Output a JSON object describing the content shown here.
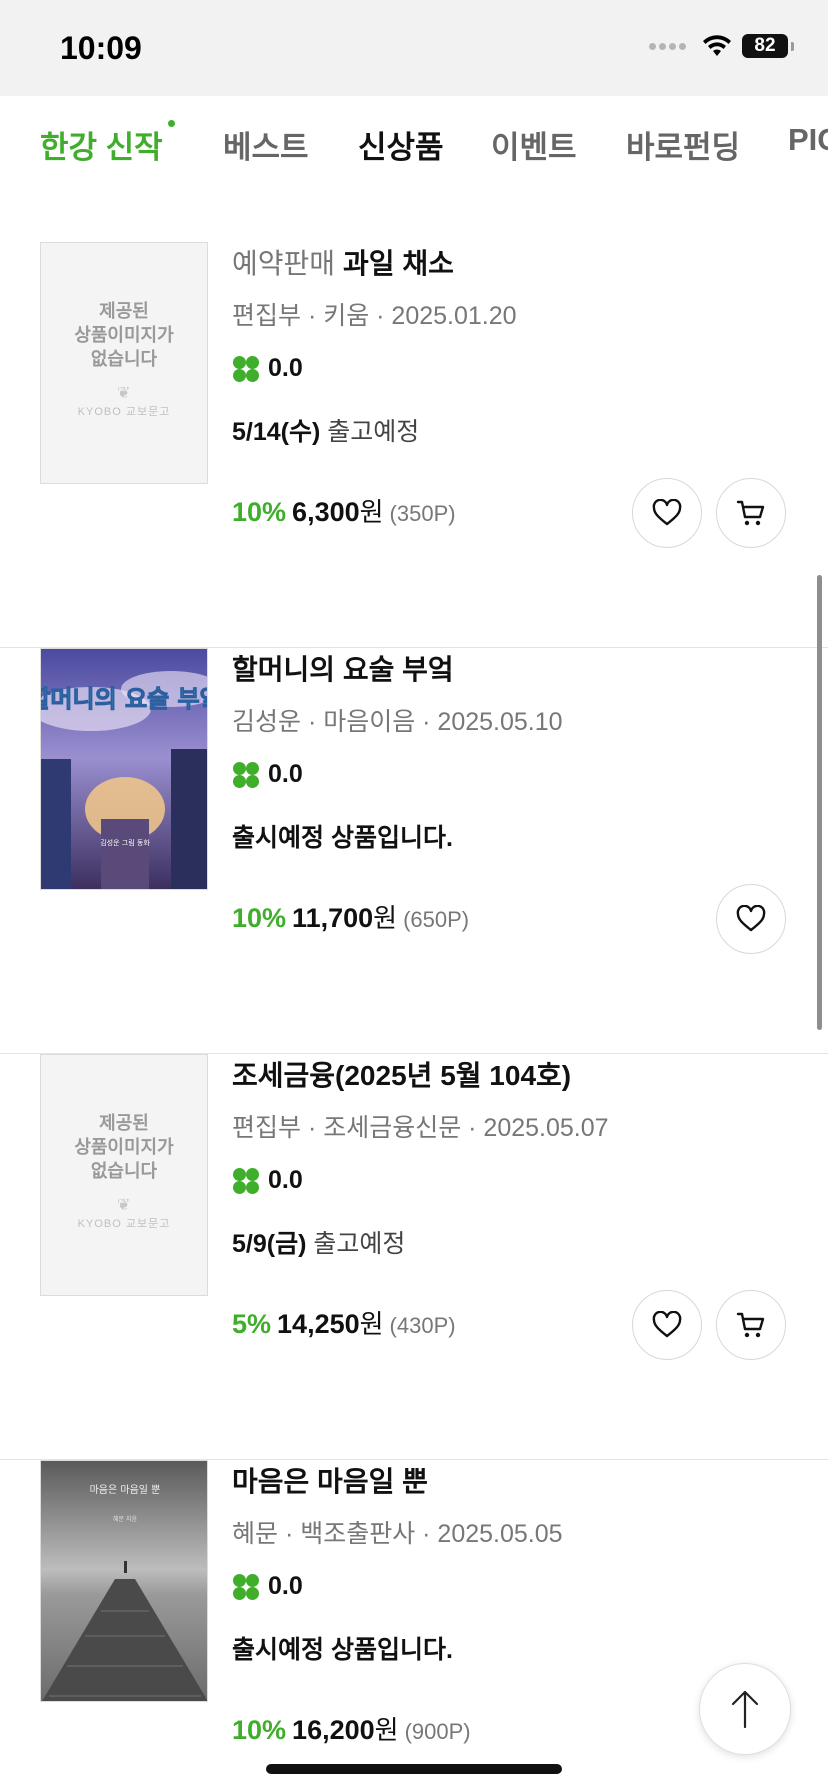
{
  "status_bar": {
    "time": "10:09",
    "battery": "82"
  },
  "tabs": [
    {
      "label": "한강 신작",
      "active": true
    },
    {
      "label": "베스트"
    },
    {
      "label": "신상품"
    },
    {
      "label": "이벤트"
    },
    {
      "label": "바로펀딩"
    },
    {
      "label": "PIC"
    }
  ],
  "placeholder": {
    "text": "제공된\n상품이미지가\n없습니다",
    "logo": "KYOBO 교보문고"
  },
  "products": [
    {
      "prefix": "예약판매",
      "title": "과일 채소",
      "meta": "편집부 · 키움 · 2025.01.20",
      "rating": "0.0",
      "ship_date": "5/14(수)",
      "ship_text": "출고예정",
      "discount": "10%",
      "price": "6,300",
      "won": "원",
      "points": "(350P)"
    },
    {
      "title": "할머니의 요술 부엌",
      "meta": "김성운 · 마음이음 · 2025.05.10",
      "rating": "0.0",
      "preorder_text": "출시예정 상품입니다.",
      "discount": "10%",
      "price": "11,700",
      "won": "원",
      "points": "(650P)",
      "cover_title": "할머니의 요술 부엌",
      "cover_author": "김성운 그림 동화"
    },
    {
      "title": "조세금융(2025년 5월 104호)",
      "meta": "편집부 · 조세금융신문 · 2025.05.07",
      "rating": "0.0",
      "ship_date": "5/9(금)",
      "ship_text": "출고예정",
      "discount": "5%",
      "price": "14,250",
      "won": "원",
      "points": "(430P)"
    },
    {
      "title": "마음은 마음일 뿐",
      "meta": "혜문 · 백조출판사 · 2025.05.05",
      "rating": "0.0",
      "preorder_text": "출시예정 상품입니다.",
      "discount": "10%",
      "price": "16,200",
      "won": "원",
      "points": "(900P)",
      "cover_title": "마음은 마음일 뿐",
      "cover_author": "혜문 지음"
    }
  ],
  "colors": {
    "accent": "#3fae2a",
    "text": "#111111",
    "muted": "#777777"
  },
  "icons": [
    "wifi-icon",
    "battery-icon",
    "heart-icon",
    "cart-icon",
    "clover-icon",
    "arrow-up-icon"
  ]
}
